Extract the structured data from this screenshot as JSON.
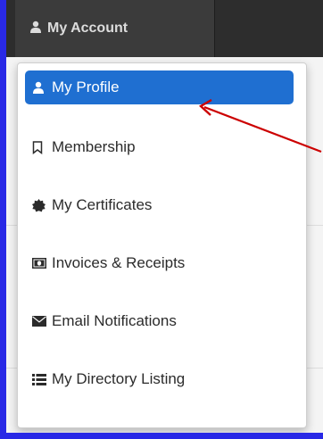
{
  "navbar": {
    "account_label": "My Account",
    "account_icon": "user-icon"
  },
  "menu": {
    "items": [
      {
        "label": "My Profile",
        "icon": "user-icon",
        "active": true
      },
      {
        "label": "Membership",
        "icon": "bookmark-icon"
      },
      {
        "label": "My Certificates",
        "icon": "certificate-icon"
      },
      {
        "label": "Invoices & Receipts",
        "icon": "money-icon"
      },
      {
        "label": "Email Notifications",
        "icon": "envelope-icon"
      },
      {
        "label": "My Directory Listing",
        "icon": "list-icon"
      }
    ]
  },
  "colors": {
    "frame_border": "#2929e6",
    "navbar": "#2d2d2d",
    "active_item": "#1f6fd1",
    "annotation_arrow": "#cc0000"
  }
}
